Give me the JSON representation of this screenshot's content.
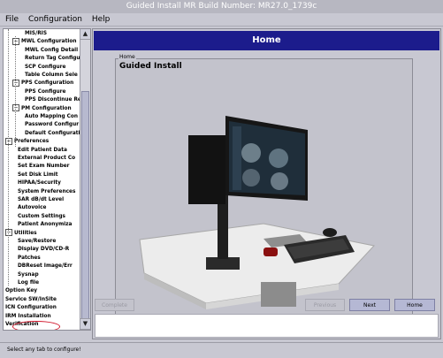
{
  "window": {
    "title": "Guided Install  MR Build Number: MR27.0_1739c"
  },
  "menubar": {
    "file": "File",
    "configuration": "Configuration",
    "help": "Help"
  },
  "tree": {
    "items": [
      {
        "label": "MIS/RIS",
        "level": 2
      },
      {
        "label": "MWL Configuration",
        "level": 1,
        "expander": "−"
      },
      {
        "label": "MWL Config Detail",
        "level": 2
      },
      {
        "label": "Return Tag Configur",
        "level": 2
      },
      {
        "label": "SCP Configure",
        "level": 2
      },
      {
        "label": "Table Column Sele",
        "level": 2
      },
      {
        "label": "PPS Configuration",
        "level": 1,
        "expander": "−"
      },
      {
        "label": "PPS Configure",
        "level": 2
      },
      {
        "label": "PPS Discontinue Re",
        "level": 2
      },
      {
        "label": "PM Configuration",
        "level": 1,
        "expander": "−"
      },
      {
        "label": "Auto Mapping Con",
        "level": 2
      },
      {
        "label": "Password Configur",
        "level": 2
      },
      {
        "label": "Default Configurati",
        "level": 2
      },
      {
        "label": "Preferences",
        "level": 0,
        "expander": "−"
      },
      {
        "label": "Edit Patient Data",
        "level": 1
      },
      {
        "label": "External Product Co",
        "level": 1
      },
      {
        "label": "Set Exam Number",
        "level": 1
      },
      {
        "label": "Set Disk Limit",
        "level": 1
      },
      {
        "label": "HIPAA/Security",
        "level": 1
      },
      {
        "label": "System Preferences",
        "level": 1
      },
      {
        "label": "SAR dB/dt Level",
        "level": 1
      },
      {
        "label": "Autovoice",
        "level": 1
      },
      {
        "label": "Custom Settings",
        "level": 1
      },
      {
        "label": "Patient Anonymiza",
        "level": 1
      },
      {
        "label": "Utilities",
        "level": 0,
        "expander": "−"
      },
      {
        "label": "Save/Restore",
        "level": 1
      },
      {
        "label": "Display DVD/CD-R",
        "level": 1
      },
      {
        "label": "Patches",
        "level": 1
      },
      {
        "label": "DBReset Image/Err",
        "level": 1
      },
      {
        "label": "Sysnap",
        "level": 1
      },
      {
        "label": "Log file",
        "level": 1
      },
      {
        "label": "Option Key",
        "level": 0
      },
      {
        "label": "Service SW/InSite",
        "level": 0
      },
      {
        "label": "ICN Configuration",
        "level": 0
      },
      {
        "label": "IRM Installation",
        "level": 0
      },
      {
        "label": "Verification",
        "level": 0
      }
    ]
  },
  "main": {
    "header": "Home",
    "group_label": "Home",
    "group_title": "Guided Install"
  },
  "buttons": {
    "complete": "Complete",
    "previous": "Previous",
    "next": "Next",
    "home": "Home"
  },
  "statusbar": {
    "text": "Select any tab to configure!"
  },
  "colors": {
    "header_bg": "#1c1c8c",
    "highlight_circle": "#d0152a",
    "panel_bg": "#c8c8d2"
  }
}
